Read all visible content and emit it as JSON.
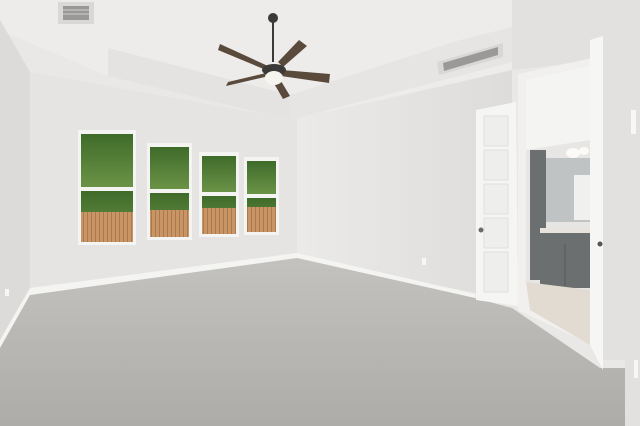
{
  "scene": {
    "kind": "photo",
    "subject": "empty-bedroom-interior",
    "palette": {
      "wall": "#e6e5e3",
      "ceiling": "#ecebe9",
      "carpet": "#b7b5b1",
      "trim": "#f3f3f1",
      "fence": "#c89563",
      "foliage": "#4f7a35",
      "cabinet": "#6b6f70",
      "floor_tile": "#e2dbd2"
    }
  }
}
